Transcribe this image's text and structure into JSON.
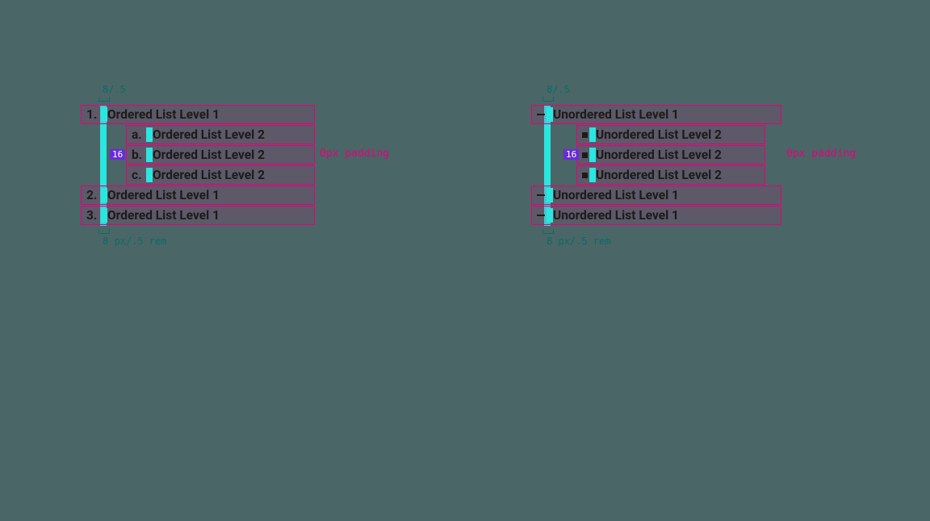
{
  "ordered": {
    "top_label": "8/.5",
    "bottom_label": "8 px/.5 rem",
    "items_l1": [
      {
        "marker": "1.",
        "text": "Ordered List Level 1"
      },
      {
        "marker": "2.",
        "text": "Ordered List Level 1"
      },
      {
        "marker": "3.",
        "text": "Ordered List Level 1"
      }
    ],
    "items_l2": [
      {
        "marker": "a.",
        "text": "Ordered List Level 2"
      },
      {
        "marker": "b.",
        "text": "Ordered List Level 2"
      },
      {
        "marker": "c.",
        "text": "Ordered List Level 2"
      }
    ],
    "indent_badge": "16",
    "side_annotation": "0px padding"
  },
  "unordered": {
    "top_label": "8/.5",
    "bottom_label": "8 px/.5 rem",
    "items_l1": [
      {
        "text": "Unordered List Level 1"
      },
      {
        "text": "Unordered List Level 1"
      },
      {
        "text": "Unordered List Level 1"
      }
    ],
    "items_l2": [
      {
        "text": "Unordered List Level 2"
      },
      {
        "text": "Unordered List Level 2"
      },
      {
        "text": "Unordered List Level 2"
      }
    ],
    "indent_badge": "16",
    "side_annotation": "0px padding"
  }
}
